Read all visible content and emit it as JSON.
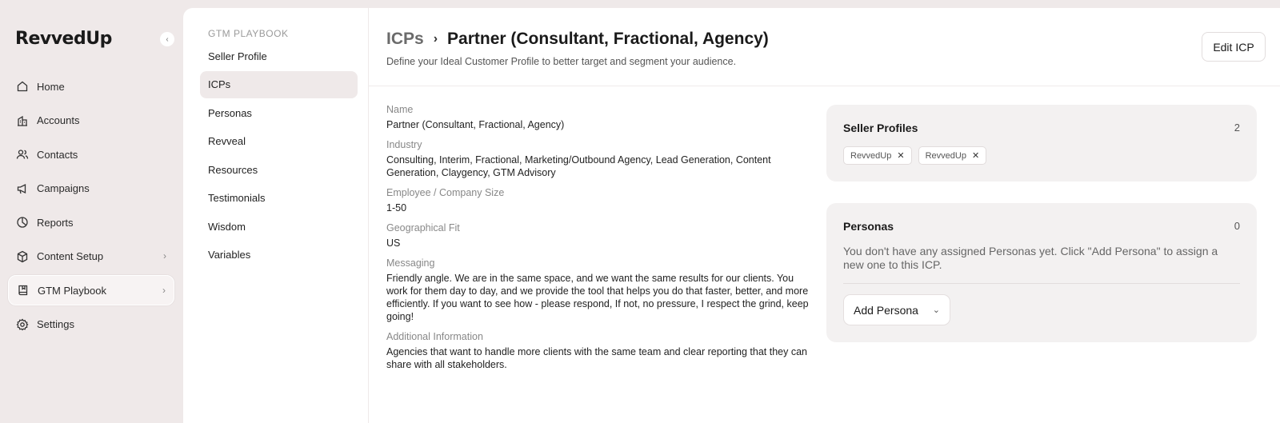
{
  "app": {
    "logo": "RevvedUp"
  },
  "sidebar": {
    "items": [
      {
        "label": "Home",
        "icon": "home-icon"
      },
      {
        "label": "Accounts",
        "icon": "building-icon"
      },
      {
        "label": "Contacts",
        "icon": "users-icon"
      },
      {
        "label": "Campaigns",
        "icon": "megaphone-icon"
      },
      {
        "label": "Reports",
        "icon": "pie-chart-icon"
      },
      {
        "label": "Content Setup",
        "icon": "cube-icon"
      },
      {
        "label": "GTM Playbook",
        "icon": "book-icon"
      },
      {
        "label": "Settings",
        "icon": "gear-icon"
      }
    ]
  },
  "subnav": {
    "title": "GTM PLAYBOOK",
    "items": [
      {
        "label": "Seller Profile"
      },
      {
        "label": "ICPs"
      },
      {
        "label": "Personas"
      },
      {
        "label": "Revveal"
      },
      {
        "label": "Resources"
      },
      {
        "label": "Testimonials"
      },
      {
        "label": "Wisdom"
      },
      {
        "label": "Variables"
      }
    ]
  },
  "header": {
    "breadcrumb_parent": "ICPs",
    "breadcrumb_current": "Partner (Consultant, Fractional, Agency)",
    "subtitle": "Define your Ideal Customer Profile to better target and segment your audience.",
    "edit_label": "Edit ICP"
  },
  "fields": [
    {
      "label": "Name",
      "value": "Partner (Consultant, Fractional, Agency)"
    },
    {
      "label": "Industry",
      "value": "Consulting, Interim, Fractional, Marketing/Outbound Agency, Lead Generation, Content Generation, Claygency, GTM Advisory"
    },
    {
      "label": "Employee / Company Size",
      "value": "1-50"
    },
    {
      "label": "Geographical Fit",
      "value": "US"
    },
    {
      "label": "Messaging",
      "value": "Friendly angle. We are in the same space, and we want the same results for our clients. You work for them day to day, and we provide the tool that helps you do that faster, better, and more efficiently. If you want to see how - please respond, If not, no pressure, I respect the grind, keep going!"
    },
    {
      "label": "Additional Information",
      "value": "Agencies that want to handle more clients with the same team and clear reporting that they can share with all stakeholders."
    }
  ],
  "seller_profiles": {
    "title": "Seller Profiles",
    "count": "2",
    "chips": [
      {
        "label": "RevvedUp"
      },
      {
        "label": "RevvedUp"
      }
    ]
  },
  "personas": {
    "title": "Personas",
    "count": "0",
    "empty_text": "You don't have any assigned Personas yet. Click \"Add Persona\" to assign a new one to this ICP.",
    "add_label": "Add Persona"
  }
}
